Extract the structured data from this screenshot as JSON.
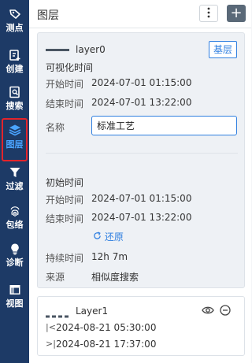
{
  "rail": {
    "items": [
      {
        "label": "测点",
        "icon": "tag-icon"
      },
      {
        "label": "创建",
        "icon": "create-icon"
      },
      {
        "label": "搜索",
        "icon": "search-doc-icon"
      },
      {
        "label": "图层",
        "icon": "layers-icon"
      },
      {
        "label": "过滤",
        "icon": "filter-icon"
      },
      {
        "label": "包络",
        "icon": "fingerprint-icon"
      },
      {
        "label": "诊断",
        "icon": "bulb-icon"
      },
      {
        "label": "视图",
        "icon": "window-icon"
      }
    ],
    "active_index": 3
  },
  "header": {
    "title": "图层",
    "more_icon": "more-vertical-icon",
    "add_label": "+"
  },
  "layer0": {
    "name": "layer0",
    "badge": "基层",
    "visible_time_title": "可视化时间",
    "start_label": "开始时间",
    "start_value": "2024-07-01 01:15:00",
    "end_label": "结束时间",
    "end_value": "2024-07-01 13:22:00",
    "name_label": "名称",
    "name_value": "标准工艺",
    "initial_title": "初始时间",
    "init_start_label": "开始时间",
    "init_start_value": "2024-07-01 01:15:00",
    "init_end_label": "结束时间",
    "init_end_value": "2024-07-01 13:22:00",
    "restore_label": "还原",
    "duration_label": "持续时间",
    "duration_value": "12h 7m",
    "source_label": "来源",
    "source_value": "相似度搜索"
  },
  "layer1": {
    "name": "Layer1",
    "start_prefix": "|<",
    "start_value": "2024-08-21 05:30:00",
    "end_prefix": ">|",
    "end_value": "2024-08-21 17:37:00"
  },
  "colors": {
    "rail": "#1d3a66",
    "accent": "#2f7fe0",
    "active_outline": "#e3242b"
  }
}
